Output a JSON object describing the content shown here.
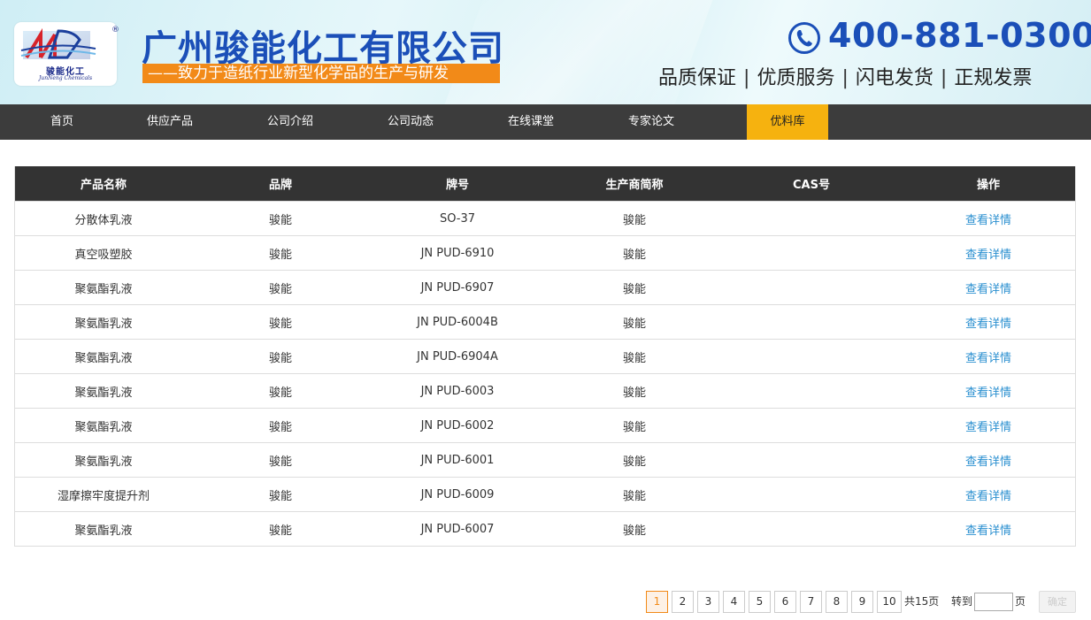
{
  "header": {
    "logo": {
      "cn": "骏能化工",
      "en": "JunNeng Chemicals",
      "reg": "®"
    },
    "company_name": "广州骏能化工有限公司",
    "slogan": "——致力于造纸行业新型化学品的生产与研发",
    "phone": "400-881-0300",
    "services": [
      "品质保证",
      "优质服务",
      "闪电发货",
      "正规发票"
    ],
    "separator": "|"
  },
  "nav": {
    "items": [
      {
        "label": "首页"
      },
      {
        "label": "供应产品"
      },
      {
        "label": "公司介绍"
      },
      {
        "label": "公司动态"
      },
      {
        "label": "在线课堂"
      },
      {
        "label": "专家论文"
      },
      {
        "label": "优料库"
      }
    ],
    "active_index": 6
  },
  "table": {
    "headers": [
      "产品名称",
      "品牌",
      "牌号",
      "生产商简称",
      "CAS号",
      "操作"
    ],
    "rows": [
      {
        "name": "分散体乳液",
        "brand": "骏能",
        "grade": "SO-37",
        "maker": "骏能",
        "cas": "",
        "action": "查看详情"
      },
      {
        "name": "真空吸塑胶",
        "brand": "骏能",
        "grade": "JN PUD-6910",
        "maker": "骏能",
        "cas": "",
        "action": "查看详情"
      },
      {
        "name": "聚氨酯乳液",
        "brand": "骏能",
        "grade": "JN PUD-6907",
        "maker": "骏能",
        "cas": "",
        "action": "查看详情"
      },
      {
        "name": "聚氨酯乳液",
        "brand": "骏能",
        "grade": "JN PUD-6004B",
        "maker": "骏能",
        "cas": "",
        "action": "查看详情"
      },
      {
        "name": "聚氨酯乳液",
        "brand": "骏能",
        "grade": "JN PUD-6904A",
        "maker": "骏能",
        "cas": "",
        "action": "查看详情"
      },
      {
        "name": "聚氨酯乳液",
        "brand": "骏能",
        "grade": "JN PUD-6003",
        "maker": "骏能",
        "cas": "",
        "action": "查看详情"
      },
      {
        "name": "聚氨酯乳液",
        "brand": "骏能",
        "grade": "JN PUD-6002",
        "maker": "骏能",
        "cas": "",
        "action": "查看详情"
      },
      {
        "name": "聚氨酯乳液",
        "brand": "骏能",
        "grade": "JN PUD-6001",
        "maker": "骏能",
        "cas": "",
        "action": "查看详情"
      },
      {
        "name": "湿摩擦牢度提升剂",
        "brand": "骏能",
        "grade": "JN PUD-6009",
        "maker": "骏能",
        "cas": "",
        "action": "查看详情"
      },
      {
        "name": "聚氨酯乳液",
        "brand": "骏能",
        "grade": "JN PUD-6007",
        "maker": "骏能",
        "cas": "",
        "action": "查看详情"
      }
    ]
  },
  "pagination": {
    "pages": [
      "1",
      "2",
      "3",
      "4",
      "5",
      "6",
      "7",
      "8",
      "9",
      "10"
    ],
    "current": "1",
    "total_text": "共15页",
    "goto_label": "转到",
    "page_unit": "页",
    "goto_value": "",
    "confirm_label": "确定"
  },
  "colors": {
    "brand_blue": "#1b4fb8",
    "slogan_orange": "#f28a18",
    "nav_bg": "#3c3c3c",
    "nav_active": "#f6b20f",
    "table_head": "#333333",
    "link": "#2a8fd0"
  }
}
